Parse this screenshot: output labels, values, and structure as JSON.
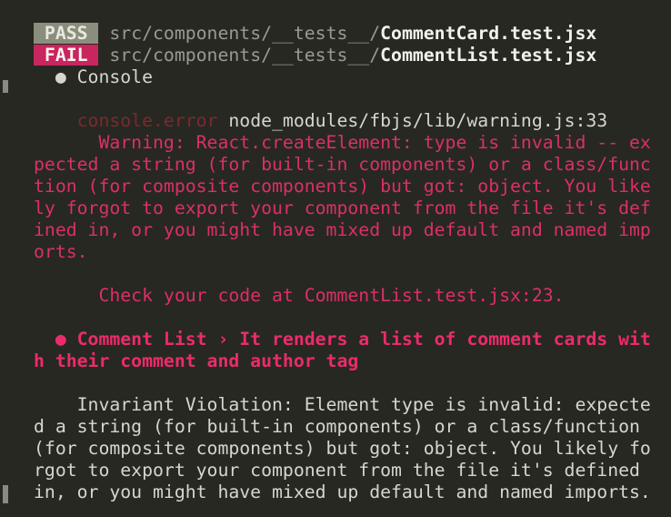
{
  "colors": {
    "background": "#272822",
    "pass_badge": "#8a8e7c",
    "fail_badge": "#c9255f",
    "error": "#dc2f68",
    "console_error": "#7a2a30"
  },
  "lines": [
    [
      {
        "t": " PASS ",
        "c": "badge-pass",
        "n": "pass-badge"
      },
      {
        "t": " src/components/__tests__/",
        "c": "path",
        "n": "test-path"
      },
      {
        "t": "CommentCard.test.jsx",
        "c": "file",
        "n": "test-file-name"
      }
    ],
    [
      {
        "t": " FAIL ",
        "c": "badge-fail",
        "n": "fail-badge"
      },
      {
        "t": " src/components/__tests__/",
        "c": "path",
        "n": "test-path"
      },
      {
        "t": "CommentList.test.jsx",
        "c": "file",
        "n": "test-file-name"
      }
    ],
    [
      {
        "t": "  ● Console",
        "c": "plain",
        "n": "console-header"
      }
    ],
    [],
    [
      {
        "t": "    console.error ",
        "c": "dim",
        "n": "console-error-label"
      },
      {
        "t": "node_modules/fbjs/lib/warning.js:33",
        "c": "plain",
        "n": "error-source"
      }
    ],
    [
      {
        "t": "      Warning: React.createElement: type is invalid -- ex",
        "c": "warn",
        "n": "warning-text"
      }
    ],
    [
      {
        "t": "pected a string (for built-in components) or a class/func",
        "c": "warn",
        "n": "warning-text"
      }
    ],
    [
      {
        "t": "tion (for composite components) but got: object. You like",
        "c": "warn",
        "n": "warning-text"
      }
    ],
    [
      {
        "t": "ly forgot to export your component from the file it's def",
        "c": "warn",
        "n": "warning-text"
      }
    ],
    [
      {
        "t": "ined in, or you might have mixed up default and named imp",
        "c": "warn",
        "n": "warning-text"
      }
    ],
    [
      {
        "t": "orts.",
        "c": "warn",
        "n": "warning-text"
      }
    ],
    [],
    [
      {
        "t": "      Check your code at CommentList.test.jsx:23.",
        "c": "warn",
        "n": "check-code-text"
      }
    ],
    [],
    [
      {
        "t": "  ● Comment List › It renders a list of comment cards wit",
        "c": "title",
        "n": "failed-test-title"
      }
    ],
    [
      {
        "t": "h their comment and author tag",
        "c": "title",
        "n": "failed-test-title"
      }
    ],
    [],
    [
      {
        "t": "    Invariant Violation: Element type is invalid: expecte",
        "c": "plain",
        "n": "error-message"
      }
    ],
    [
      {
        "t": "d a string (for built-in components) or a class/function ",
        "c": "plain",
        "n": "error-message"
      }
    ],
    [
      {
        "t": "(for composite components) but got: object. You likely fo",
        "c": "plain",
        "n": "error-message"
      }
    ],
    [
      {
        "t": "rgot to export your component from the file it's defined ",
        "c": "plain",
        "n": "error-message"
      }
    ],
    [
      {
        "t": "in, or you might have mixed up default and named imports.",
        "c": "plain",
        "n": "error-message"
      }
    ]
  ]
}
